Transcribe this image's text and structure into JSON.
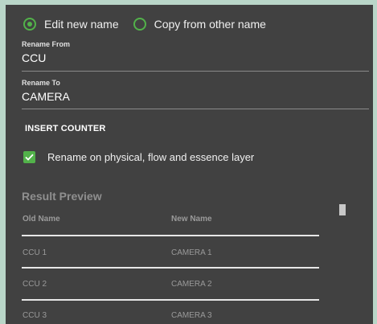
{
  "mode": {
    "options": [
      {
        "label": "Edit new name",
        "checked": true
      },
      {
        "label": "Copy from other name",
        "checked": false
      }
    ]
  },
  "rename_from": {
    "label": "Rename From",
    "value": "CCU"
  },
  "rename_to": {
    "label": "Rename To",
    "value": "CAMERA"
  },
  "insert_counter_label": "INSERT COUNTER",
  "layers_option": {
    "label": "Rename on physical, flow and essence layer",
    "checked": true
  },
  "preview": {
    "title": "Result Preview",
    "columns": [
      "Old Name",
      "New Name"
    ],
    "rows": [
      {
        "old": "CCU 1",
        "new": "CAMERA 1"
      },
      {
        "old": "CCU 2",
        "new": "CAMERA 2"
      },
      {
        "old": "CCU 3",
        "new": "CAMERA 3"
      }
    ]
  },
  "colors": {
    "accent": "#52b24a",
    "panel_background": "#414141",
    "outer_background": "#b9d6c8"
  }
}
